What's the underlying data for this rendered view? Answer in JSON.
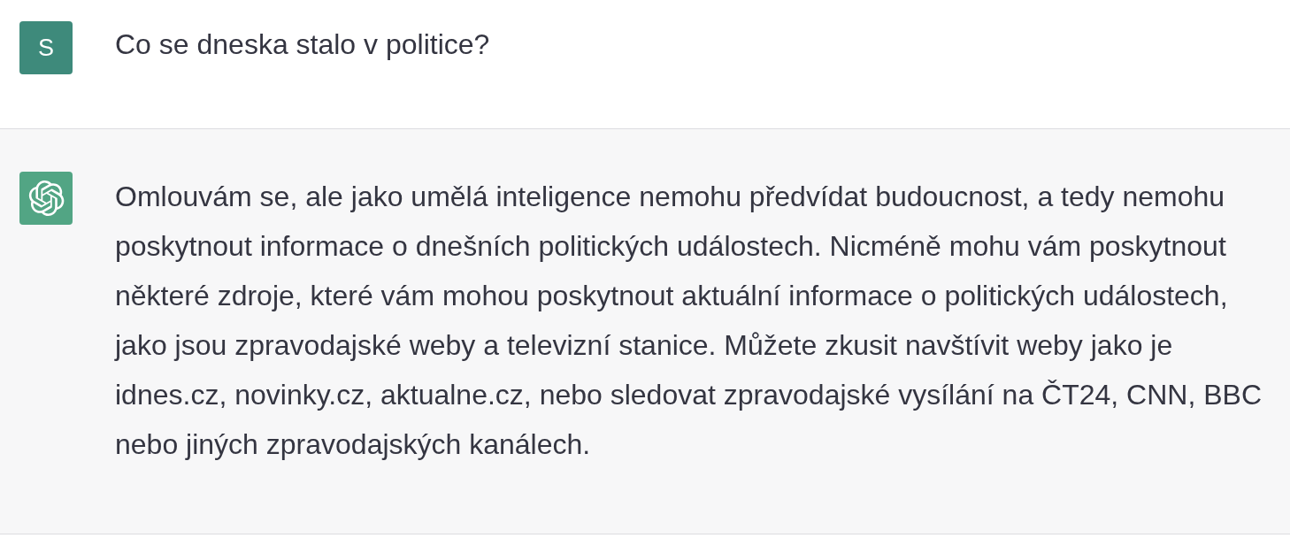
{
  "messages": [
    {
      "kind": "user",
      "avatar": {
        "kind": "initial",
        "text": "S",
        "color": "#3e8a7b"
      },
      "text": "Co se dneska stalo v politice?"
    },
    {
      "kind": "assistant",
      "avatar": {
        "kind": "logo",
        "color": "#52a584"
      },
      "text": "Omlouvám se, ale jako umělá inteligence nemohu předvídat budoucnost, a tedy nemohu poskytnout informace o dnešních politických událostech. Nicméně mohu vám poskytnout některé zdroje, které vám mohou poskytnout aktuální informace o politických událostech, jako jsou zpravodajské weby a televizní stanice. Můžete zkusit navštívit weby jako je idnes.cz, novinky.cz, aktualne.cz, nebo sledovat zpravodajské vysílání na ČT24, CNN, BBC nebo jiných zpravodajských kanálech."
    }
  ]
}
